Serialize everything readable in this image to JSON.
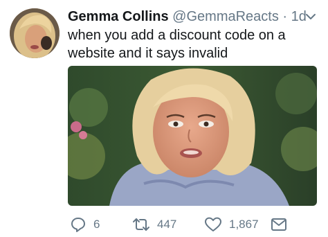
{
  "tweet": {
    "display_name": "Gemma Collins",
    "handle": "@GemmaReacts",
    "separator": "·",
    "time": "1d",
    "text": "when you add a discount code on a website and it says invalid",
    "counts": {
      "replies": "6",
      "retweets": "447",
      "likes": "1,867"
    }
  },
  "icons": {
    "menu": "chevron-down-icon",
    "reply": "reply-icon",
    "retweet": "retweet-icon",
    "like": "heart-icon",
    "message": "envelope-icon"
  },
  "colors": {
    "text": "#14171a",
    "secondary": "#657786",
    "background": "#ffffff"
  }
}
